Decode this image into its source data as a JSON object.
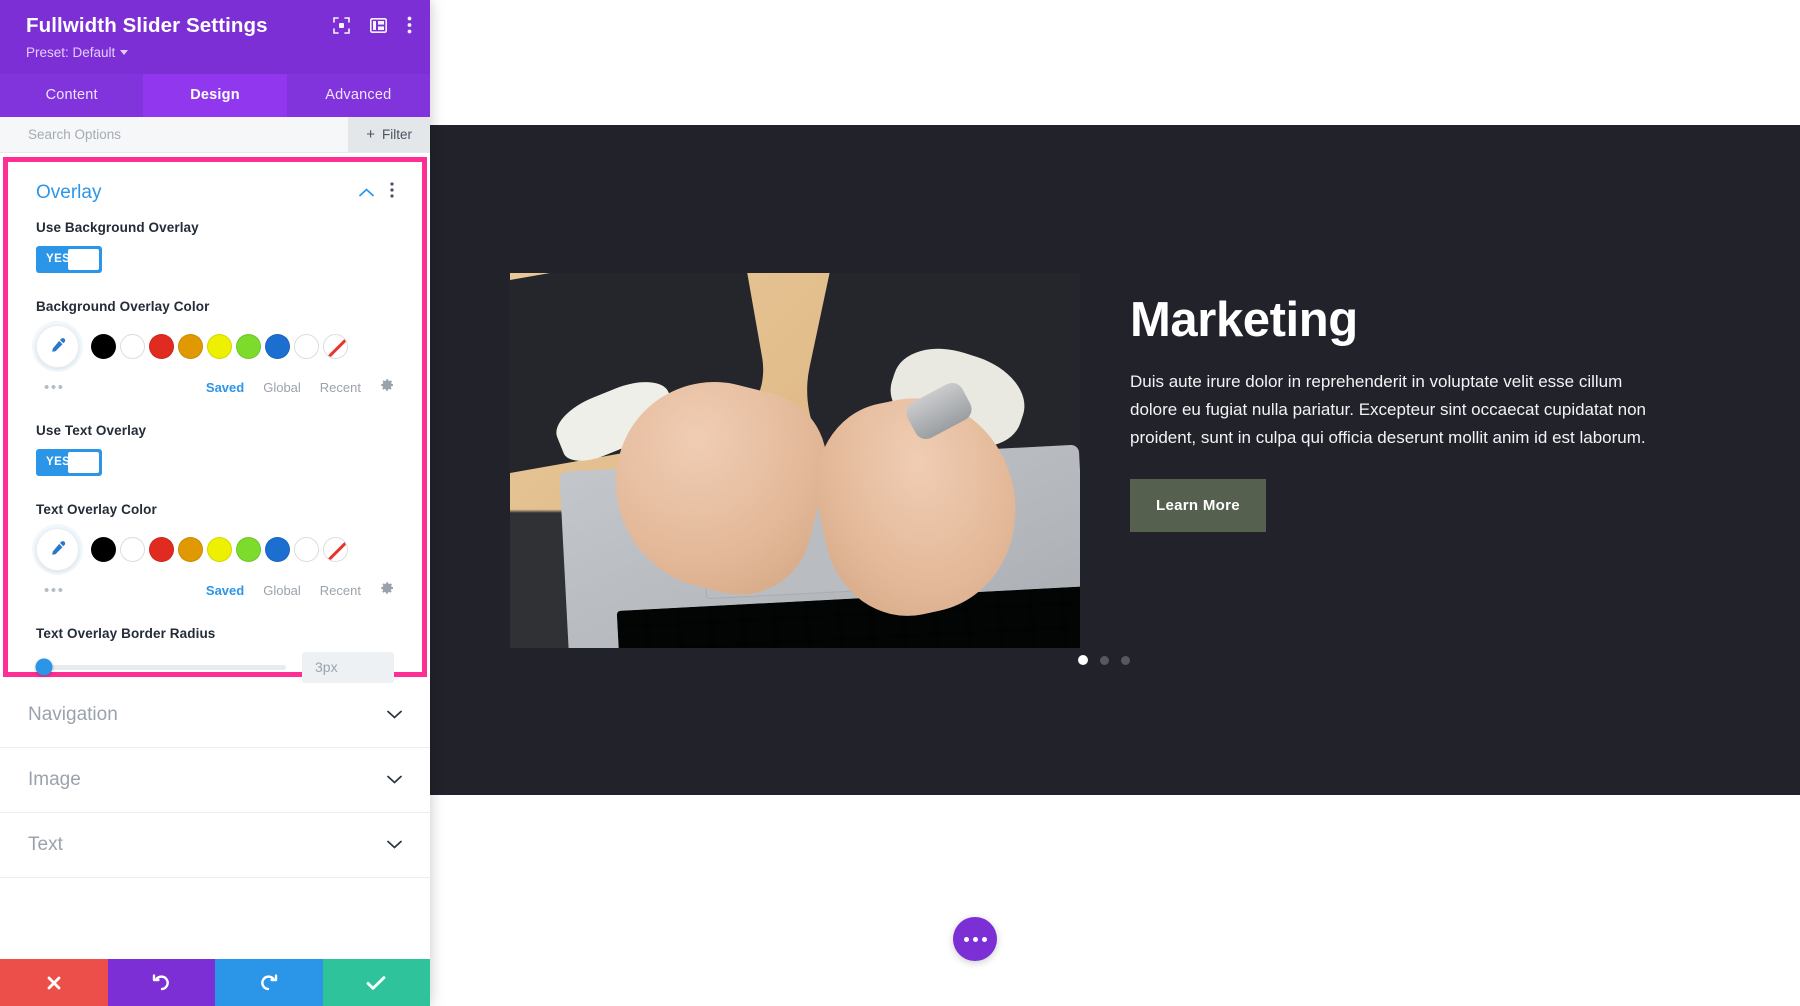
{
  "panel": {
    "title": "Fullwidth Slider Settings",
    "preset_label": "Preset: Default",
    "header_icons": [
      "fullscreen-icon",
      "layout-columns-icon",
      "kebab-menu-icon"
    ],
    "tabs": [
      {
        "label": "Content",
        "active": false
      },
      {
        "label": "Design",
        "active": true
      },
      {
        "label": "Advanced",
        "active": false
      }
    ],
    "search": {
      "placeholder": "Search Options",
      "value": ""
    },
    "filter_button": {
      "label": "Filter",
      "icon": "plus-icon"
    },
    "sections_open": [
      {
        "title": "Overlay",
        "collapse_icon": "chevron-up-icon",
        "menu_icon": "kebab-menu-icon",
        "fields": [
          {
            "label": "Use Background Overlay",
            "type": "toggle",
            "value": "YES"
          },
          {
            "label": "Background Overlay Color",
            "type": "color",
            "picker_icon": "eyedropper-icon",
            "more_icon": "ellipsis-icon",
            "swatches": [
              "#000000",
              "#ffffff",
              "#e02b20",
              "#e09900",
              "#edf000",
              "#7cdb2b",
              "#1c6fd0",
              "#ffffff",
              "transparent"
            ],
            "links": [
              {
                "label": "Saved",
                "active": true
              },
              {
                "label": "Global",
                "active": false
              },
              {
                "label": "Recent",
                "active": false
              }
            ],
            "gear_icon": "gear-icon"
          },
          {
            "label": "Use Text Overlay",
            "type": "toggle",
            "value": "YES"
          },
          {
            "label": "Text Overlay Color",
            "type": "color",
            "picker_icon": "eyedropper-icon",
            "more_icon": "ellipsis-icon",
            "swatches": [
              "#000000",
              "#ffffff",
              "#e02b20",
              "#e09900",
              "#edf000",
              "#7cdb2b",
              "#1c6fd0",
              "#ffffff",
              "transparent"
            ],
            "links": [
              {
                "label": "Saved",
                "active": true
              },
              {
                "label": "Global",
                "active": false
              },
              {
                "label": "Recent",
                "active": false
              }
            ],
            "gear_icon": "gear-icon"
          },
          {
            "label": "Text Overlay Border Radius",
            "type": "range",
            "value": "3px",
            "slider_percent": 2
          }
        ]
      }
    ],
    "sections_closed": [
      {
        "title": "Navigation",
        "icon": "chevron-down-icon"
      },
      {
        "title": "Image",
        "icon": "chevron-down-icon"
      },
      {
        "title": "Text",
        "icon": "chevron-down-icon"
      }
    ],
    "footer_actions": [
      {
        "name": "cancel-button",
        "icon": "close-x-icon",
        "color": "#ec4f4a"
      },
      {
        "name": "undo-button",
        "icon": "undo-arrow-icon",
        "color": "#7b2fd4"
      },
      {
        "name": "redo-button",
        "icon": "redo-arrow-icon",
        "color": "#2b96e8"
      },
      {
        "name": "save-button",
        "icon": "checkmark-icon",
        "color": "#2fc39b"
      }
    ],
    "highlight_color": "#ff2e93"
  },
  "preview": {
    "slide": {
      "heading": "Marketing",
      "body": "Duis aute irure dolor in reprehenderit in voluptate velit esse cillum dolore eu fugiat nulla pariatur. Excepteur sint occaecat cupidatat non proident, sunt in culpa qui officia deserunt mollit anim id est laborum.",
      "button_label": "Learn More",
      "button_color": "#55604f",
      "background_color": "#22222b",
      "image_alt": "hands-typing-on-laptop-photo",
      "dots": [
        {
          "active": true
        },
        {
          "active": false
        },
        {
          "active": false
        }
      ]
    },
    "fab": {
      "icon": "ellipsis-icon",
      "color": "#7b2fd4"
    }
  }
}
